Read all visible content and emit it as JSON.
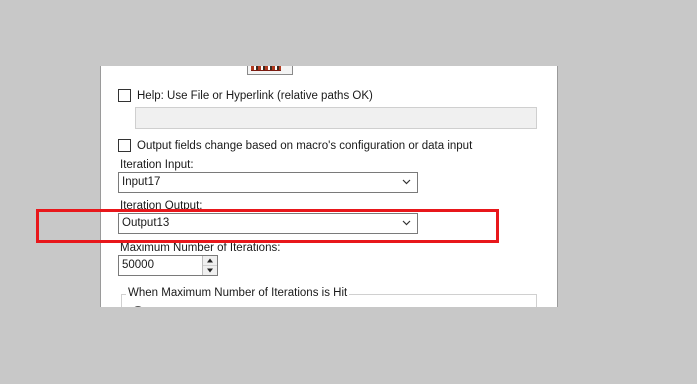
{
  "help": {
    "checkbox_label": "Help: Use File or Hyperlink (relative paths OK)",
    "checked": false,
    "path_value": ""
  },
  "output_fields": {
    "checkbox_label": "Output fields change based on macro's configuration or data input",
    "checked": false
  },
  "iteration_input": {
    "label": "Iteration Input:",
    "value": "Input17"
  },
  "iteration_output": {
    "label": "Iteration Output:",
    "value": "Output13"
  },
  "max_iterations": {
    "label": "Maximum Number of Iterations:",
    "value": "50000"
  },
  "max_hit_group": {
    "title": "When Maximum Number of Iterations is Hit"
  },
  "icons": {
    "dropdown": "chevron-down-icon",
    "spin_up": "triangle-up-icon",
    "spin_down": "triangle-down-icon"
  },
  "colors": {
    "highlight": "#e8171b",
    "background": "#c8c8c8",
    "panel": "#ffffff"
  }
}
